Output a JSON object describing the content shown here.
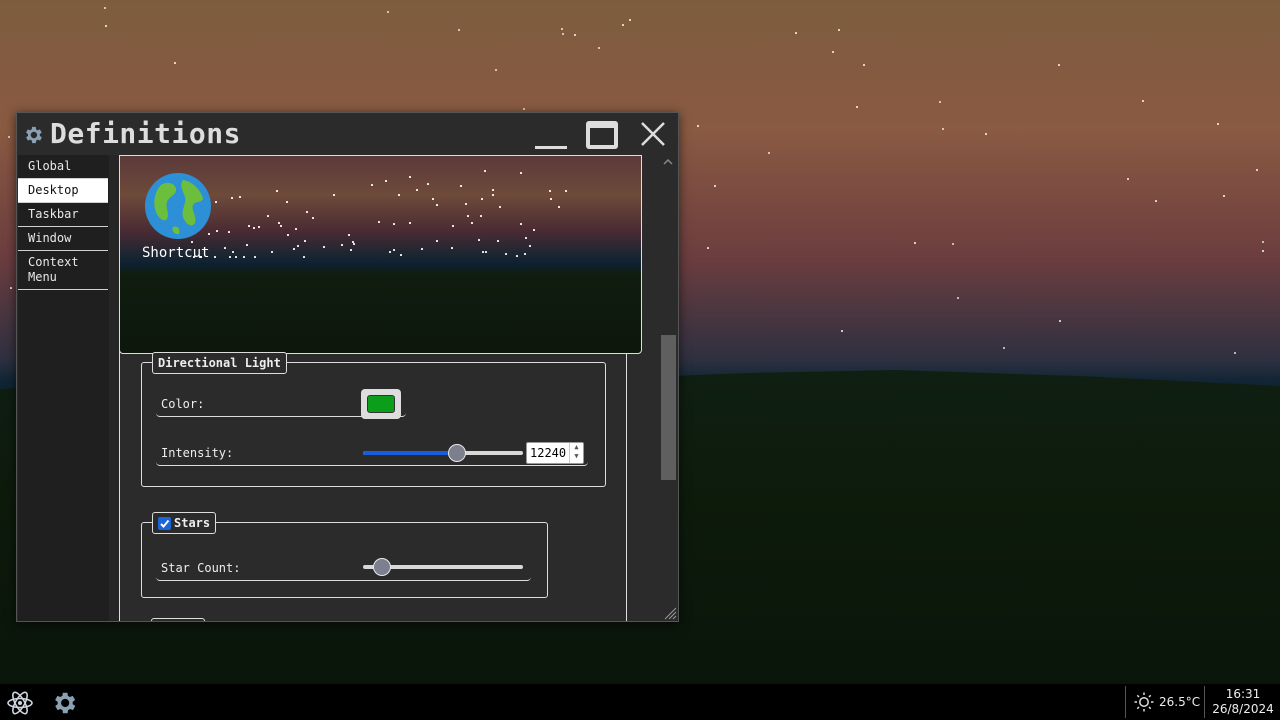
{
  "window": {
    "title": "Definitions"
  },
  "sidebar": {
    "items": [
      {
        "label": "Global"
      },
      {
        "label": "Desktop"
      },
      {
        "label": "Taskbar"
      },
      {
        "label": "Window"
      },
      {
        "label": "Context Menu"
      }
    ],
    "active": "Desktop"
  },
  "preview": {
    "shortcut_label": "Shortcut",
    "shortcut_icon": "globe-icon"
  },
  "directional_light": {
    "legend": "Directional Light",
    "color_label": "Color:",
    "color_value": "#0a9e1a",
    "intensity_label": "Intensity:",
    "intensity_value": "12240",
    "intensity_fraction": 0.6
  },
  "stars": {
    "legend": "Stars",
    "enabled": true,
    "star_count_label": "Star Count:",
    "star_count_fraction": 0.07
  },
  "taskbar": {
    "start_icon": "atom-icon",
    "app_icon": "gear-icon",
    "weather_icon": "sun-icon",
    "temperature": "26.5°C",
    "time": "16:31",
    "date": "26/8/2024"
  },
  "colors": {
    "accent": "#1a5ce0",
    "window_bg": "#2b2b2b",
    "sidebar_bg": "#1f1f1f"
  }
}
